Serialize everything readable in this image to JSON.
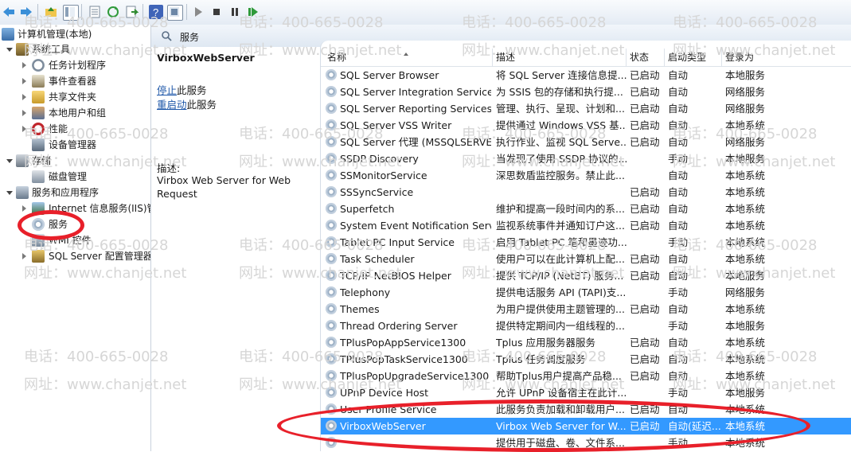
{
  "tree": {
    "items": [
      {
        "label": "计算机管理(本地)",
        "icon": "computer-management-icon"
      },
      {
        "label": "系统工具",
        "icon": "system-tools-icon"
      },
      {
        "label": "任务计划程序",
        "icon": "clock-icon"
      },
      {
        "label": "事件查看器",
        "icon": "event-viewer-icon"
      },
      {
        "label": "共享文件夹",
        "icon": "shared-folder-icon"
      },
      {
        "label": "本地用户和组",
        "icon": "users-icon"
      },
      {
        "label": "性能",
        "icon": "performance-icon"
      },
      {
        "label": "设备管理器",
        "icon": "device-manager-icon"
      },
      {
        "label": "存储",
        "icon": "storage-icon"
      },
      {
        "label": "磁盘管理",
        "icon": "disk-icon"
      },
      {
        "label": "服务和应用程序",
        "icon": "services-apps-icon"
      },
      {
        "label": "Internet 信息服务(IIS)管",
        "icon": "iis-icon"
      },
      {
        "label": "服务",
        "icon": "gear-icon"
      },
      {
        "label": "WMI 控件",
        "icon": "wmi-icon"
      },
      {
        "label": "SQL Server 配置管理器",
        "icon": "sql-config-icon"
      }
    ]
  },
  "header": {
    "title": "服务"
  },
  "detail": {
    "service_name": "VirboxWebServer",
    "stop_link": "停止",
    "stop_suffix": "此服务",
    "restart_link": "重启动",
    "restart_suffix": "此服务",
    "desc_label": "描述:",
    "desc_text": "Virbox Web Server for Web Request"
  },
  "columns": {
    "name": "名称",
    "desc": "描述",
    "status": "状态",
    "startup": "启动类型",
    "logon": "登录为"
  },
  "services": [
    {
      "name": "SQL Server Browser",
      "desc": "将 SQL Server 连接信息提...",
      "status": "已启动",
      "startup": "自动",
      "logon": "本地服务"
    },
    {
      "name": "SQL Server Integration Services...",
      "desc": "为 SSIS 包的存储和执行提...",
      "status": "已启动",
      "startup": "自动",
      "logon": "网络服务"
    },
    {
      "name": "SQL Server Reporting Services ...",
      "desc": "管理、执行、呈现、计划和...",
      "status": "已启动",
      "startup": "自动",
      "logon": "网络服务"
    },
    {
      "name": "SQL Server VSS Writer",
      "desc": "提供通过 Windows VSS 基...",
      "status": "已启动",
      "startup": "自动",
      "logon": "本地系统"
    },
    {
      "name": "SQL Server 代理 (MSSQLSERVER)",
      "desc": "执行作业、监视 SQL Serve...",
      "status": "已启动",
      "startup": "自动",
      "logon": "网络服务"
    },
    {
      "name": "SSDP Discovery",
      "desc": "当发现了使用 SSDP 协议的...",
      "status": "",
      "startup": "手动",
      "logon": "本地服务"
    },
    {
      "name": "SSMonitorService",
      "desc": "深思数盾监控服务。禁止此...",
      "status": "",
      "startup": "自动",
      "logon": "本地系统"
    },
    {
      "name": "SSSyncService",
      "desc": "",
      "status": "已启动",
      "startup": "自动",
      "logon": "本地系统"
    },
    {
      "name": "Superfetch",
      "desc": "维护和提高一段时间内的系...",
      "status": "已启动",
      "startup": "自动",
      "logon": "本地系统"
    },
    {
      "name": "System Event Notification Service",
      "desc": "监视系统事件并通知订户这...",
      "status": "已启动",
      "startup": "自动",
      "logon": "本地系统"
    },
    {
      "name": "Tablet PC Input Service",
      "desc": "启用 Tablet PC 笔和墨迹功...",
      "status": "",
      "startup": "手动",
      "logon": "本地系统"
    },
    {
      "name": "Task Scheduler",
      "desc": "使用户可以在此计算机上配...",
      "status": "已启动",
      "startup": "自动",
      "logon": "本地系统"
    },
    {
      "name": "TCP/IP NetBIOS Helper",
      "desc": "提供 TCP/IP (NetBT) 服务...",
      "status": "已启动",
      "startup": "自动",
      "logon": "本地服务"
    },
    {
      "name": "Telephony",
      "desc": "提供电话服务 API (TAPI)支...",
      "status": "",
      "startup": "手动",
      "logon": "网络服务"
    },
    {
      "name": "Themes",
      "desc": "为用户提供使用主题管理的...",
      "status": "已启动",
      "startup": "自动",
      "logon": "本地系统"
    },
    {
      "name": "Thread Ordering Server",
      "desc": "提供特定期间内一组线程的...",
      "status": "",
      "startup": "手动",
      "logon": "本地服务"
    },
    {
      "name": "TPlusPopAppService1300",
      "desc": "Tplus 应用服务器服务",
      "status": "已启动",
      "startup": "自动",
      "logon": "本地系统"
    },
    {
      "name": "TPlusPopTaskService1300",
      "desc": "Tplus 任务调度服务",
      "status": "已启动",
      "startup": "自动",
      "logon": "本地系统"
    },
    {
      "name": "TPlusPopUpgradeService1300",
      "desc": "帮助Tplus用户提高产品稳...",
      "status": "已启动",
      "startup": "自动",
      "logon": "本地系统"
    },
    {
      "name": "UPnP Device Host",
      "desc": "允许 UPnP 设备宿主在此计...",
      "status": "",
      "startup": "手动",
      "logon": "本地服务"
    },
    {
      "name": "User Profile Service",
      "desc": "此服务负责加载和卸载用户...",
      "status": "已启动",
      "startup": "自动",
      "logon": "本地系统"
    },
    {
      "name": "VirboxWebServer",
      "desc": "Virbox Web Server for W...",
      "status": "已启动",
      "startup": "自动(延迟...",
      "logon": "本地系统",
      "selected": true
    },
    {
      "name": "",
      "desc": "提供用于磁盘、卷、文件系...",
      "status": "",
      "startup": "手动",
      "logon": "本地系统"
    }
  ],
  "watermark": {
    "phone": "电话：400-665-0028",
    "site": "网址：www.chanjet.net"
  }
}
